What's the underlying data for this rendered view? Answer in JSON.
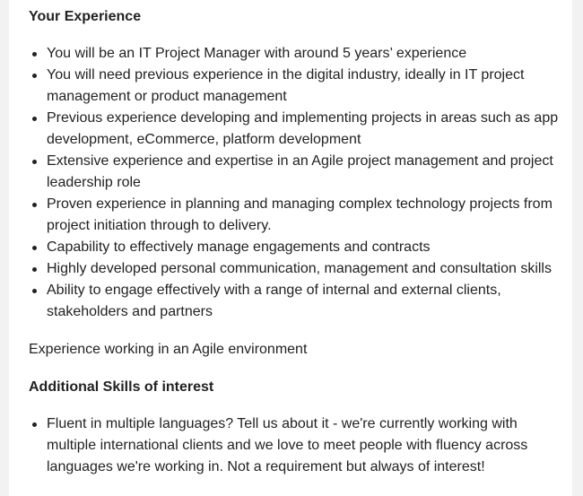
{
  "section1": {
    "heading": "Your Experience",
    "items": [
      "You will be an IT Project Manager with around 5 years’ experience",
      "You will need previous experience in the digital industry, ideally in IT project management or product management",
      "Previous experience developing and implementing projects in areas such as app development, eCommerce, platform development",
      "Extensive experience and expertise in an Agile project management and project leadership role",
      "Proven experience in planning and managing complex technology projects from project initiation through to delivery.",
      "Capability to effectively manage engagements and contracts",
      "Highly developed personal communication, management and consultation skills",
      "Ability to engage effectively with a range of internal and external clients, stakeholders and partners"
    ]
  },
  "paragraph": "Experience working in an Agile environment",
  "section2": {
    "heading": "Additional Skills of interest",
    "items": [
      "Fluent in multiple languages? Tell us about it - we're currently working with multiple international clients and we love to meet people with fluency across languages we're working in. Not a requirement but always of interest!"
    ]
  }
}
